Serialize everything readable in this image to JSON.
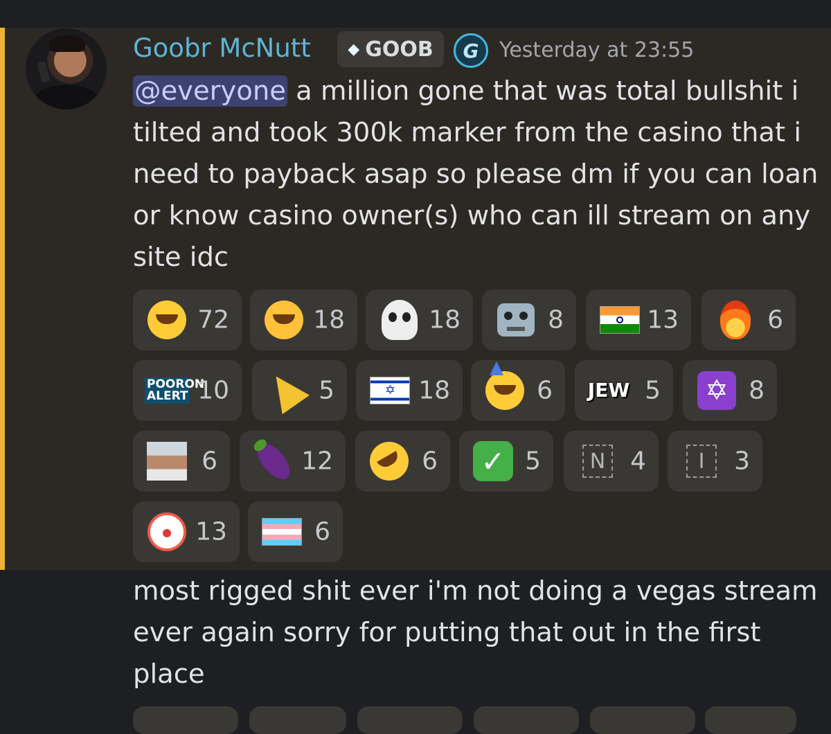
{
  "message": {
    "author": "Goobr McNutt",
    "guild_tag": "GOOB",
    "badge_letter": "G",
    "timestamp": "Yesterday at 23:55",
    "mention": "@everyone",
    "text1": " a million gone that was total bullshit i tilted and took 300k marker from the casino that i need to payback asap so please dm if you can loan or know casino owner(s) who can ill stream on any site idc",
    "text2": "most rigged shit ever i'm not doing a vegas stream ever again sorry for putting that out in the first place"
  },
  "reactions": [
    {
      "icon": "joy-emoji-icon",
      "count": "72"
    },
    {
      "icon": "sob-emoji-icon",
      "count": "18"
    },
    {
      "icon": "skull-emoji-icon",
      "count": "18"
    },
    {
      "icon": "robot-emoji-icon",
      "count": "8"
    },
    {
      "icon": "india-flag-icon",
      "count": "13"
    },
    {
      "icon": "fire-emoji-icon",
      "count": "6"
    },
    {
      "icon": "pooron-alert-custom-icon",
      "label": "POORON ALERT",
      "count": "10"
    },
    {
      "icon": "party-popper-icon",
      "count": "5"
    },
    {
      "icon": "israel-flag-icon",
      "count": "18"
    },
    {
      "icon": "partying-face-icon",
      "count": "6"
    },
    {
      "icon": "jew-custom-icon",
      "label": "JEW",
      "count": "5"
    },
    {
      "icon": "star-of-david-icon",
      "count": "8"
    },
    {
      "icon": "man-photo-custom-icon",
      "count": "6"
    },
    {
      "icon": "eggplant-icon",
      "count": "12"
    },
    {
      "icon": "rofl-emoji-icon",
      "count": "6"
    },
    {
      "icon": "check-mark-icon",
      "count": "5"
    },
    {
      "icon": "regional-n-icon",
      "label": "N",
      "count": "4"
    },
    {
      "icon": "regional-i-icon",
      "label": "I",
      "count": "3"
    },
    {
      "icon": "clown-face-icon",
      "count": "13"
    },
    {
      "icon": "transgender-flag-icon",
      "count": "6"
    }
  ],
  "colors": {
    "background": "#1e1f22",
    "highlight": "#2c2924",
    "highlight_bar": "#f0b232",
    "username": "#5fb4d6",
    "mention_bg": "#3d4270"
  }
}
